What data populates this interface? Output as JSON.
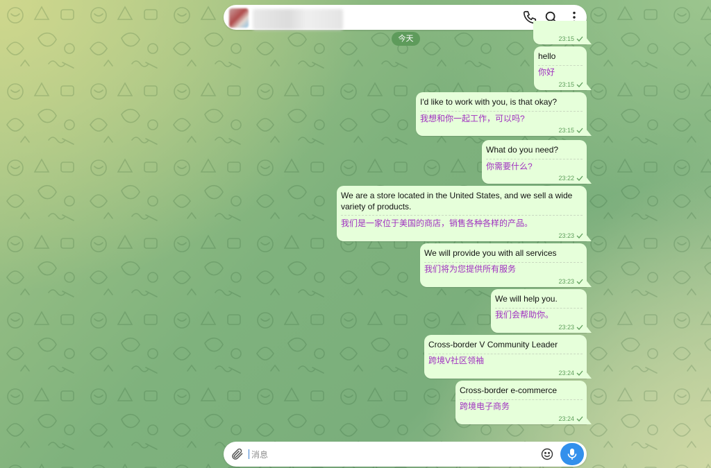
{
  "header": {
    "contact_name": "",
    "call_icon": "phone-icon",
    "search_icon": "search-icon",
    "menu_icon": "more-vertical-icon"
  },
  "date_separator": "今天",
  "partial_top_message": {
    "time": "23:15"
  },
  "messages": [
    {
      "en": "hello",
      "zh": "你好",
      "time": "23:15",
      "status": "read"
    },
    {
      "en": "I'd like to work with you, is that okay?",
      "zh": "我想和你一起工作，可以吗?",
      "time": "23:15",
      "status": "read"
    },
    {
      "en": "What do you need?",
      "zh": "你需要什么?",
      "time": "23:22",
      "status": "read"
    },
    {
      "en": "We are a store located in the United States, and we sell a wide variety of products.",
      "zh": "我们是一家位于美国的商店，销售各种各样的产品。",
      "time": "23:23",
      "status": "read"
    },
    {
      "en": "We will provide you with all services",
      "zh": "我们将为您提供所有服务",
      "time": "23:23",
      "status": "read"
    },
    {
      "en": "We will help you.",
      "zh": "我们会帮助你。",
      "time": "23:23",
      "status": "read"
    },
    {
      "en": "Cross-border V Community Leader",
      "zh": "跨境V社区领袖",
      "time": "23:24",
      "status": "read"
    },
    {
      "en": "Cross-border e-commerce",
      "zh": "跨境电子商务",
      "time": "23:24",
      "status": "read"
    }
  ],
  "composer": {
    "placeholder": "消息",
    "value": "",
    "attach_icon": "paperclip-icon",
    "emoji_icon": "emoji-icon",
    "mic_icon": "microphone-icon"
  },
  "colors": {
    "outgoing_bubble": "#e6ffda",
    "translation_text": "#a030c0",
    "time_text": "#5e9e5b",
    "date_pill": "#5e9b5b",
    "mic_button": "#3390ec"
  }
}
